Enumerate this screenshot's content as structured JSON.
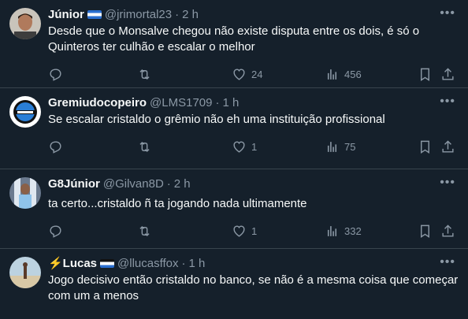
{
  "tweets": [
    {
      "name": "Júnior",
      "handle": "@jrimortal23",
      "dot": "·",
      "time": "2 h",
      "text": "Desde que o Monsalve chegou não existe disputa entre os dois, é só o Quinteros ter culhão e escalar o melhor",
      "likes": "24",
      "views": "456"
    },
    {
      "name": "Gremiudocopeiro",
      "handle": "@LMS1709",
      "dot": "·",
      "time": "1 h",
      "text": "Se escalar cristaldo o grêmio não eh uma instituição profissional",
      "likes": "1",
      "views": "75"
    },
    {
      "name": "G8Júnior",
      "handle": "@Gilvan8D",
      "dot": "·",
      "time": "2 h",
      "text": "ta certo...cristaldo ñ ta jogando nada ultimamente",
      "likes": "1",
      "views": "332"
    },
    {
      "name": "⚡Lucas",
      "handle": "@llucasffox",
      "dot": "·",
      "time": "1 h",
      "text": "Jogo decisivo então cristaldo no banco, se não é a mesma coisa que começar com um a menos",
      "likes": "",
      "views": ""
    }
  ],
  "colors": {
    "background": "#15202b",
    "secondary_text": "#8b98a5",
    "divider": "#38444d"
  },
  "icons": [
    "reply-icon",
    "retweet-icon",
    "like-icon",
    "views-icon",
    "bookmark-icon",
    "share-icon",
    "more-icon"
  ]
}
